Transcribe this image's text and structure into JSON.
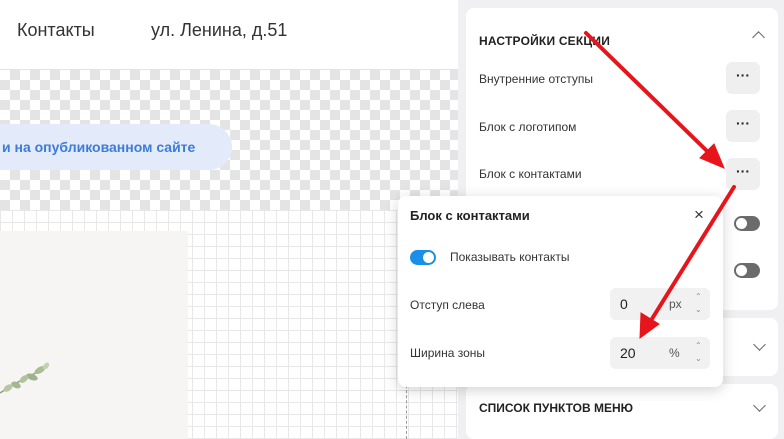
{
  "topbar": {
    "nav_contacts": "Контакты",
    "address": "ул. Ленина, д.51"
  },
  "canvas": {
    "notice": "и на опубликованном сайте"
  },
  "settings": {
    "section_title": "НАСТРОЙКИ СЕКЦИИ",
    "rows": [
      {
        "label": "Внутренние отступы",
        "action": "···"
      },
      {
        "label": "Блок с логотипом",
        "action": "···"
      },
      {
        "label": "Блок с контактами",
        "action": "···"
      }
    ],
    "menu_items_title": "СПИСОК ПУНКТОВ МЕНЮ"
  },
  "popup": {
    "title": "Блок с контактами",
    "close": "×",
    "show_contacts_label": "Показывать контакты",
    "show_contacts_on": true,
    "left_offset_label": "Отступ слева",
    "left_offset_value": "0",
    "left_offset_unit": "px",
    "zone_width_label": "Ширина зоны",
    "zone_width_value": "20",
    "zone_width_unit": "%",
    "spin_up": "⌃",
    "spin_down": "⌄"
  },
  "colors": {
    "accent": "#1a8fe8",
    "annotation_arrow": "#e8141c",
    "notice_bg": "#e3ebfb",
    "notice_text": "#3d7bd9"
  }
}
